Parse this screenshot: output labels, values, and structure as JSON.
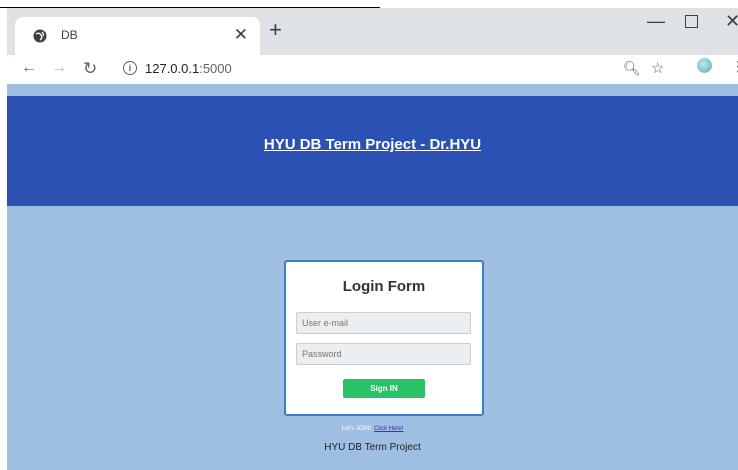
{
  "browser": {
    "tab_title": "DB",
    "tab_close": "✕",
    "new_tab": "+",
    "url_host": "127.0.0.1",
    "url_port": ":5000",
    "controls": {
      "minimize": "—",
      "close": "✕"
    }
  },
  "header": {
    "title": "HYU DB Term Project - Dr.HYU"
  },
  "login": {
    "title": "Login Form",
    "email_placeholder": "User e-mail",
    "password_placeholder": "Password",
    "submit_label": "Sign IN"
  },
  "join": {
    "prompt": "Let's JOIN!",
    "link_label": "Click Here!"
  },
  "footer": {
    "text": "HYU DB Term Project"
  },
  "colors": {
    "page_bg": "#9fbfe2",
    "header_bg": "#2b52b3",
    "button_bg": "#29c266",
    "card_border": "#3b7cc6"
  }
}
